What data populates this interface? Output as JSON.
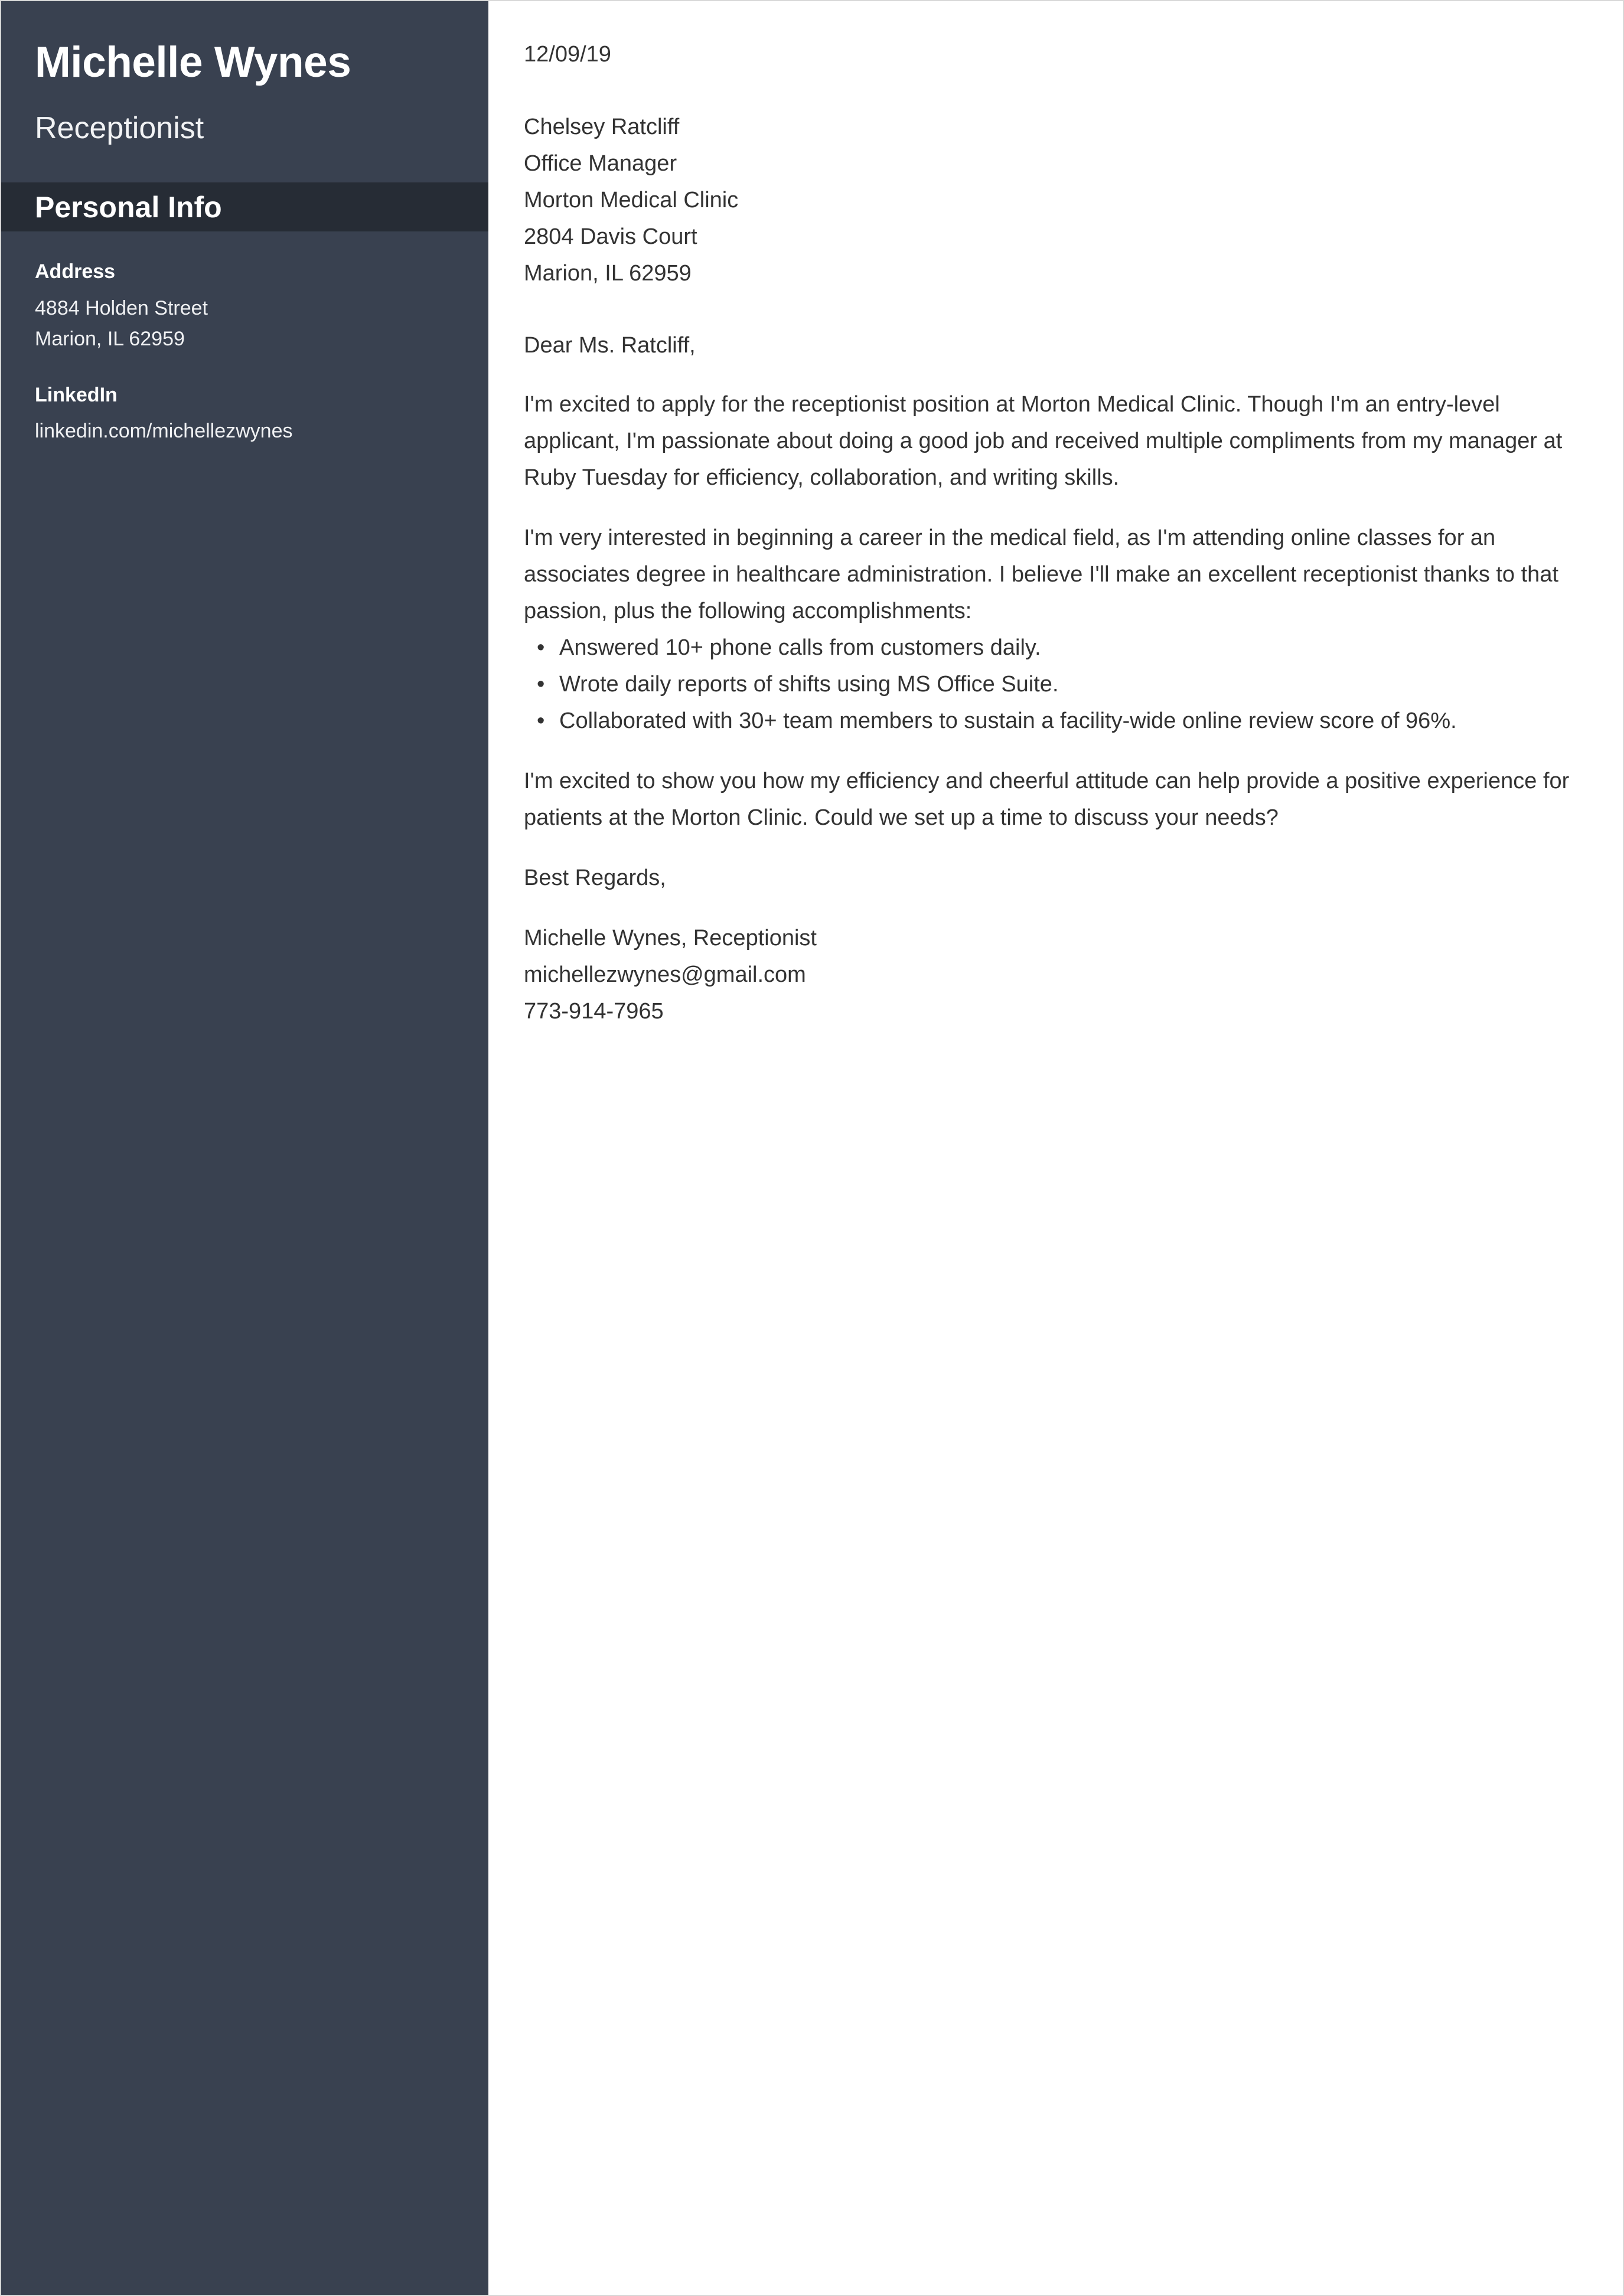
{
  "sidebar": {
    "name": "Michelle Wynes",
    "job_title": "Receptionist",
    "section_title": "Personal Info",
    "info_groups": [
      {
        "label": "Address",
        "lines": [
          "4884 Holden Street",
          "Marion, IL 62959"
        ]
      },
      {
        "label": "LinkedIn",
        "lines": [
          "linkedin.com/michellezwynes"
        ]
      }
    ],
    "background_color": "#394150",
    "band_color": "#262c35"
  },
  "letter": {
    "date": "12/09/19",
    "recipient": {
      "name": "Chelsey Ratcliff",
      "job_title": "Office Manager",
      "company": "Morton Medical Clinic",
      "street": "2804 Davis Court",
      "city_state_zip": "Marion, IL 62959"
    },
    "salutation": "Dear Ms. Ratcliff,",
    "paragraph_1": "I'm excited to apply for the receptionist position at Morton Medical Clinic. Though I'm an entry-level applicant, I'm passionate about doing a good job and received multiple compliments from my manager at Ruby Tuesday for efficiency, collaboration, and writing skills.",
    "paragraph_2": "I'm very interested in beginning a career in the medical field, as I'm attending online classes for an associates degree in healthcare administration. I believe I'll make an excellent receptionist thanks to that passion, plus the following accomplishments:",
    "bullets": [
      "Answered 10+ phone calls from customers daily.",
      "Wrote daily reports of shifts using MS Office Suite.",
      "Collaborated with 30+ team members to sustain a facility-wide online review score of 96%."
    ],
    "paragraph_3": "I'm excited to show you how my efficiency and cheerful attitude can help provide a positive experience for patients at the Morton Clinic. Could we set up a time to discuss your needs?",
    "closing": "Best Regards,",
    "signature": {
      "name_title": "Michelle Wynes, Receptionist",
      "email": "michellezwynes@gmail.com",
      "phone": "773-914-7965"
    },
    "text_color": "#333333"
  }
}
